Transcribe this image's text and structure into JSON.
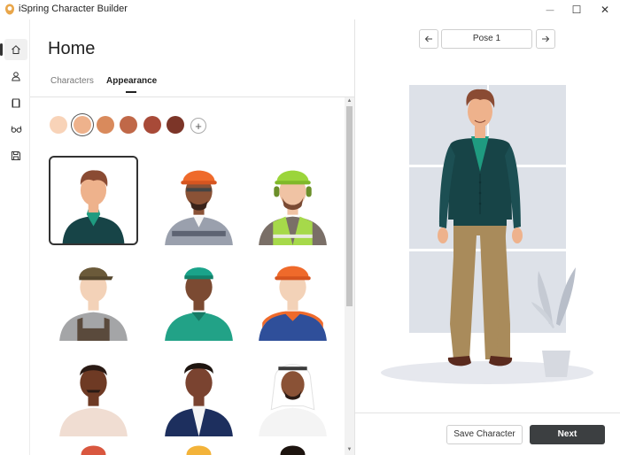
{
  "app": {
    "title": "iSpring Character Builder",
    "logo_icon": "ispring-logo-icon"
  },
  "window_controls": {
    "minimize": "—",
    "maximize": "☐",
    "close": "✕"
  },
  "sidebar": {
    "items": [
      {
        "name": "home",
        "icon": "home-icon",
        "active": true
      },
      {
        "name": "character",
        "icon": "person-icon",
        "active": false
      },
      {
        "name": "clothes",
        "icon": "shirt-icon",
        "active": false
      },
      {
        "name": "accessories",
        "icon": "glasses-icon",
        "active": false
      },
      {
        "name": "save",
        "icon": "save-icon",
        "active": false
      }
    ]
  },
  "page": {
    "title": "Home"
  },
  "tabs": [
    {
      "label": "Characters",
      "active": false
    },
    {
      "label": "Appearance",
      "active": true
    }
  ],
  "skin_tones": {
    "colors": [
      "#f8d3b8",
      "#eeb28c",
      "#d98a5c",
      "#c06848",
      "#a84a38",
      "#7c3528"
    ],
    "selected_index": 1,
    "add_label": "+"
  },
  "characters": [
    {
      "name": "casual-man",
      "selected": true
    },
    {
      "name": "construction-worker-orange-helmet"
    },
    {
      "name": "worker-yellow-helmet-vest"
    },
    {
      "name": "worker-cap-overalls"
    },
    {
      "name": "worker-teal-cap"
    },
    {
      "name": "engineer-orange-helmet"
    },
    {
      "name": "man-beige-shirt"
    },
    {
      "name": "man-navy-suit"
    },
    {
      "name": "man-white-keffiyeh"
    }
  ],
  "pose": {
    "label": "Pose 1",
    "prev_icon": "arrow-left-icon",
    "next_icon": "arrow-right-icon"
  },
  "buttons": {
    "save": "Save Character",
    "next": "Next"
  },
  "colors": {
    "accent_dark": "#3c3f41",
    "cardigan": "#174447",
    "pants": "#a98b5b",
    "shirt": "#1f9b80"
  }
}
